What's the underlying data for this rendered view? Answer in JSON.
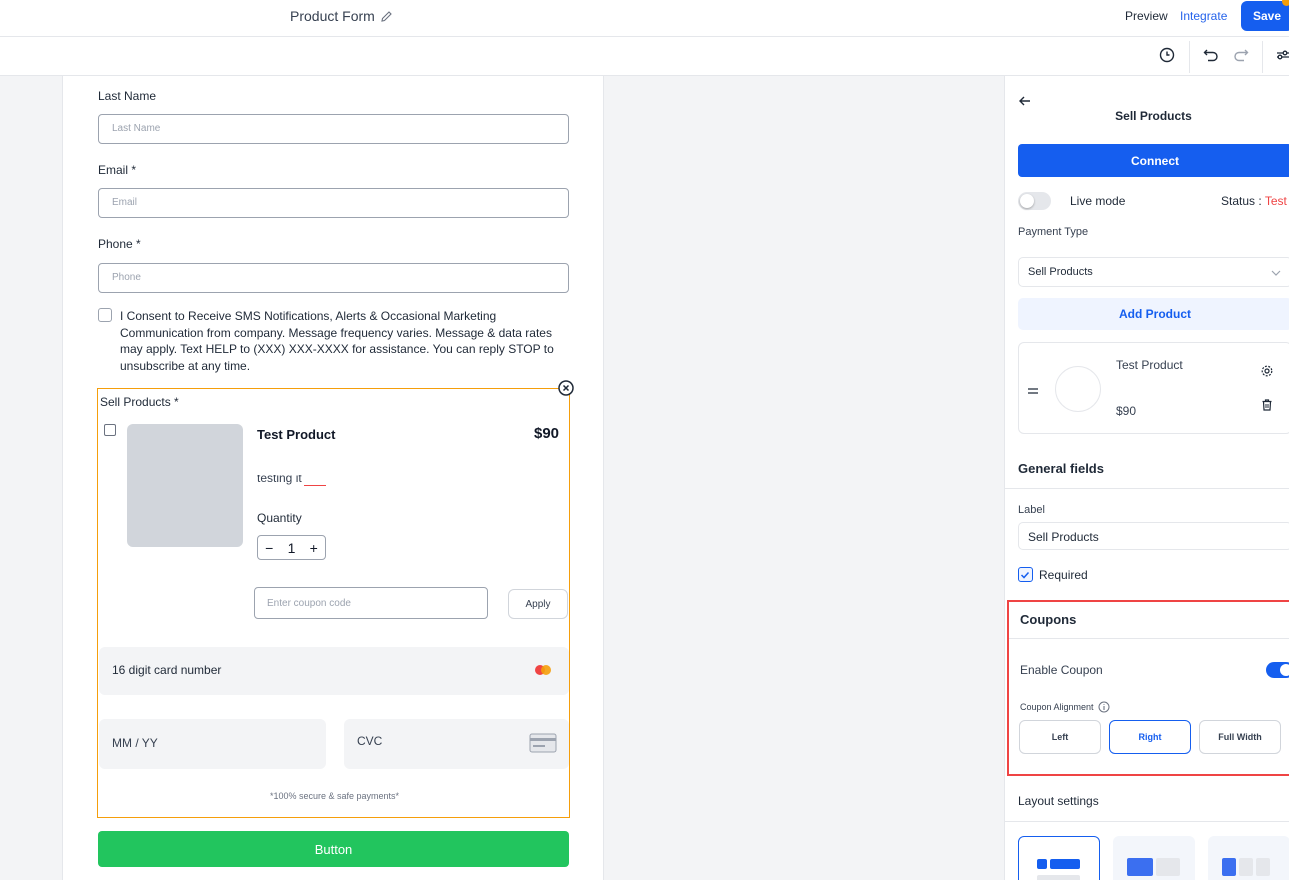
{
  "header": {
    "form_title": "Product Form",
    "preview_label": "Preview",
    "integrate_label": "Integrate",
    "save_label": "Save"
  },
  "form": {
    "last_name": {
      "label": "Last Name",
      "placeholder": "Last Name"
    },
    "email": {
      "label": "Email *",
      "placeholder": "Email"
    },
    "phone": {
      "label": "Phone *",
      "placeholder": "Phone"
    },
    "consent_text": "I Consent to Receive SMS Notifications, Alerts & Occasional Marketing Communication from company. Message frequency varies. Message & data rates may apply. Text HELP to (XXX) XXX-XXXX for assistance. You can reply STOP to unsubscribe at any time.",
    "sell_products": {
      "label": "Sell Products *",
      "product_name": "Test Product",
      "product_price": "$90",
      "product_description": "testing it",
      "quantity_label": "Quantity",
      "quantity_minus": "−",
      "quantity_value": "1",
      "quantity_plus": "+",
      "coupon_placeholder": "Enter coupon code",
      "apply_label": "Apply",
      "card_number_placeholder": "16 digit card number",
      "expiry_placeholder": "MM / YY",
      "cvc_placeholder": "CVC",
      "secure_text": "*100% secure & safe payments*"
    },
    "submit_label": "Button"
  },
  "panel": {
    "title": "Sell Products",
    "connect_label": "Connect",
    "live_mode_label": "Live mode",
    "live_mode_on": false,
    "status_label": "Status : ",
    "status_value": "Test",
    "payment_type_label": "Payment Type",
    "payment_type_value": "Sell Products",
    "add_product_label": "Add Product",
    "product_card": {
      "name": "Test Product",
      "price": "$90"
    },
    "general_fields_title": "General fields",
    "label_field_label": "Label",
    "label_field_value": "Sell Products",
    "required_label": "Required",
    "required_checked": true,
    "coupons": {
      "title": "Coupons",
      "enable_label": "Enable Coupon",
      "enabled": true,
      "alignment_label": "Coupon Alignment",
      "alignment_options": [
        "Left",
        "Right",
        "Full Width"
      ],
      "alignment_selected": "Right"
    },
    "layout_settings_title": "Layout settings"
  },
  "colors": {
    "primary": "#155eef",
    "submit_green": "#22c55e",
    "highlight_red": "#ef4444",
    "block_outline": "#f59e0b"
  }
}
